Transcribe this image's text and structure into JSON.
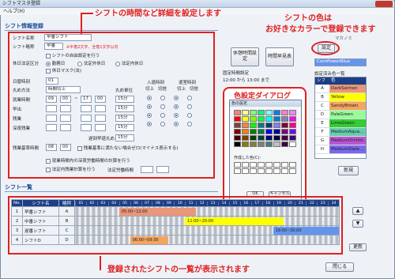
{
  "window": {
    "title": "シフトマスタ登録",
    "menu": "ヘルプ(H)"
  },
  "callouts": {
    "top": "シフトの時間など詳細を設定します",
    "right_line1": "シフトの色は",
    "right_line2": "お好きなカラーで登録できます",
    "dialog": "色設定ダイアログ",
    "bottom": "登録されたシフトの一覧が表示されます"
  },
  "info": {
    "section_title": "シフト情報登録",
    "name_label": "シフト名称",
    "name_value": "早番シフト",
    "abbr_label": "シフト略称",
    "abbr_value": "早番",
    "abbr_note": "※半角2文字、全角1文字以内",
    "auto_label": "シフトの自由設定を行う",
    "holiday_label": "休日法定区分",
    "holiday_opts": [
      "勤務日",
      "法定外休日",
      "法定内休日"
    ],
    "holiday_mask": "休日マスク(法)",
    "daychange_label": "日替時刻",
    "daychange_value": "01",
    "rounding_label": "丸め方法",
    "rounding_value": "時間切上",
    "rounding_unit_label": "丸め単位",
    "col_in": "入退時刻",
    "col_in_sub": [
      "切上",
      "切捨"
    ],
    "col_out": "退室時刻",
    "col_out_sub": [
      "切上",
      "切捨"
    ],
    "rows": [
      {
        "label": "就業時間",
        "from_h": "09",
        "from_m": "00",
        "to_h": "17",
        "to_m": "00",
        "unit": "15分"
      },
      {
        "label": "早出",
        "from_h": "",
        "from_m": "",
        "to_h": "",
        "to_m": "",
        "unit": "15分"
      },
      {
        "label": "残業",
        "from_h": "",
        "from_m": "",
        "to_h": "",
        "to_m": "",
        "unit": "15分"
      },
      {
        "label": "深夜残業",
        "from_h": "",
        "from_m": "",
        "to_h": "",
        "to_m": "",
        "unit": "15分"
      }
    ],
    "overtime_label": "遅刻早退丸め",
    "overtime_unit": "15分",
    "base_label": "残業基準時間",
    "base_h": "08",
    "base_m": "00",
    "base_check": "残業基準に満たない場合ゼロ(マイナス表示する)",
    "night_check": "就業時間内の深夜労働時間の計算を行う",
    "legal_check": "法定内残業計算を行う",
    "legal_label": "法定労働時間"
  },
  "buttons": {
    "holiday_set": "休憩時間設定",
    "early_table": "時間早見表",
    "color_set": "設定",
    "new": "新規",
    "update": "更新",
    "close": "閉じる",
    "dlg_ok": "OK",
    "dlg_cancel": "キャンセル"
  },
  "legal_hours": {
    "label": "固定時間設定",
    "value": "12:00 から 13:00 まで"
  },
  "color_panel": {
    "small_label": "マカノミ",
    "current": "CornflowerBlue",
    "list_title": "設定済み色一覧",
    "head_shift": "シフト",
    "head_color": "色",
    "items": [
      {
        "shift": "A",
        "name": "DarkSalmon",
        "hex": "#e9967a"
      },
      {
        "shift": "B",
        "name": "Yellow",
        "hex": "#ffff00"
      },
      {
        "shift": "C",
        "name": "SandyBrown",
        "hex": "#f4a460"
      },
      {
        "shift": "D",
        "name": "PaleGreen",
        "hex": "#98fb98"
      },
      {
        "shift": "E",
        "name": "LimeGreen",
        "hex": "#32cd32"
      },
      {
        "shift": "F",
        "name": "MediumAqua...",
        "hex": "#66cdaa"
      },
      {
        "shift": "G",
        "name": "MediumOrchid...",
        "hex": "#ba55d3"
      },
      {
        "shift": "H",
        "name": "MediumSlate...",
        "hex": "#7b68ee"
      }
    ]
  },
  "dialog": {
    "title": "色の設定",
    "custom_label": "作成した色(C):"
  },
  "list": {
    "section_title": "シフト一覧",
    "headers": [
      "No.",
      "シフト名",
      "略称",
      "01",
      "02",
      "03",
      "04",
      "05",
      "06",
      "07",
      "08",
      "09",
      "10",
      "11",
      "12",
      "13",
      "14",
      "15",
      "16",
      "17",
      "18",
      "19",
      "20",
      "21",
      "22",
      "23",
      "24"
    ],
    "rows": [
      {
        "no": "1",
        "name": "早番シフト",
        "abbr": "A",
        "bar": "05:00~12:00",
        "color": "#e9967a"
      },
      {
        "no": "2",
        "name": "中番シフト",
        "abbr": "B",
        "bar": "11:00~20:00",
        "color": "#ffff00"
      },
      {
        "no": "3",
        "name": "遅番シフト",
        "abbr": "C",
        "bar": "19:00~30:00",
        "color": "#6495ed"
      },
      {
        "no": "4",
        "name": "シフトD",
        "abbr": "D",
        "bar": "06:00~09:30",
        "color": "#f4a460"
      }
    ]
  }
}
